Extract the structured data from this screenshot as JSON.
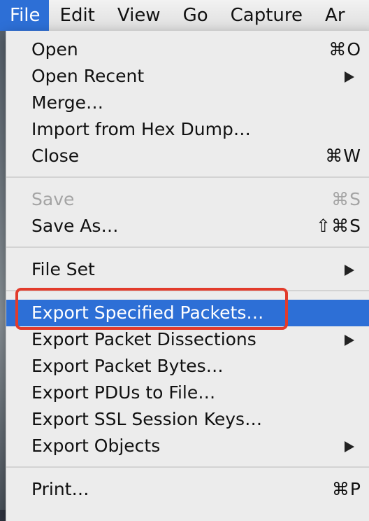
{
  "menubar": {
    "items": [
      "File",
      "Edit",
      "View",
      "Go",
      "Capture",
      "Ar"
    ],
    "active_index": 0
  },
  "file_menu": {
    "items": [
      {
        "label": "Open",
        "shortcut": "⌘O"
      },
      {
        "label": "Open Recent",
        "submenu": true
      },
      {
        "label": "Merge…"
      },
      {
        "label": "Import from Hex Dump…"
      },
      {
        "label": "Close",
        "shortcut": "⌘W"
      },
      {
        "label": "Save",
        "shortcut": "⌘S",
        "disabled": true
      },
      {
        "label": "Save As…",
        "shortcut": "⇧⌘S"
      },
      {
        "label": "File Set",
        "submenu": true
      },
      {
        "label": "Export Specified Packets…",
        "highlighted": true
      },
      {
        "label": "Export Packet Dissections",
        "submenu": true
      },
      {
        "label": "Export Packet Bytes…"
      },
      {
        "label": "Export PDUs to File…"
      },
      {
        "label": "Export SSL Session Keys…"
      },
      {
        "label": "Export Objects",
        "submenu": true
      },
      {
        "label": "Print…",
        "shortcut": "⌘P"
      }
    ]
  },
  "annotation": {
    "target": "Export Specified Packets…",
    "color": "#e23b2b"
  },
  "colors": {
    "highlight": "#2d6fd6",
    "menu_bg": "#ececec",
    "disabled_text": "#a4a4a4"
  }
}
